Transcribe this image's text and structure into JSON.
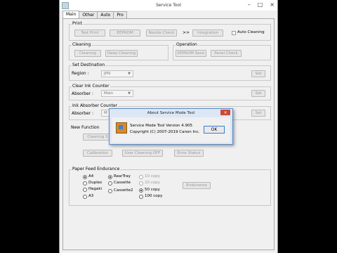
{
  "window": {
    "title": "Service Tool",
    "min": "–",
    "max": "□",
    "close": "×"
  },
  "tabs": [
    "Main",
    "Other",
    "Auto",
    "Pro"
  ],
  "print": {
    "label": "Print",
    "test_print": "Test Print",
    "eeprom": "EEPROM",
    "nozzle_check": "Nozzle Check",
    "arrows": ">>",
    "integration": "Integration",
    "auto_cleaning": "Auto Cleaning"
  },
  "cleaning": {
    "label": "Cleaning",
    "cleaning": "Cleaning",
    "deep_cleaning": "Deep Cleaning"
  },
  "operation": {
    "label": "Operation",
    "eeprom_save": "EEPROM Save",
    "panel_check": "Panel Check"
  },
  "set_destination": {
    "label": "Set Destination",
    "region_label": "Region :",
    "region_value": "JPN",
    "set": "Set"
  },
  "clear_ink": {
    "label": "Clear Ink Counter",
    "absorber_label": "Absorber :",
    "absorber_value": "Main",
    "set": "Set"
  },
  "ink_absorber": {
    "label": "Ink Absorber Counter",
    "absorber_label": "Absorber :",
    "absorber_value": "M",
    "set": "Set"
  },
  "new_function": {
    "label": "New Function",
    "cleaning_btn": "Cleaning S",
    "calibration": "Calibration",
    "user_cleaning": "User Cleaning OFF",
    "error_status": "Error Status"
  },
  "paper_feed": {
    "label": "Paper Feed Endurance",
    "sizes": [
      "A4",
      "Duplex",
      "Hagaki",
      "A3"
    ],
    "trays": [
      "RearTray",
      "Cassette",
      "Cassette2"
    ],
    "copies": [
      "10 copy",
      "20 copy",
      "50 copy",
      "100 copy"
    ],
    "endurance": "Endurance"
  },
  "dialog": {
    "title": "About Service Mode Tool",
    "close": "×",
    "line1": "Service Mode Tool  Version 4.905",
    "line2": "Copyright (C) 2007-2019 Canon Inc.",
    "ok": "OK"
  }
}
